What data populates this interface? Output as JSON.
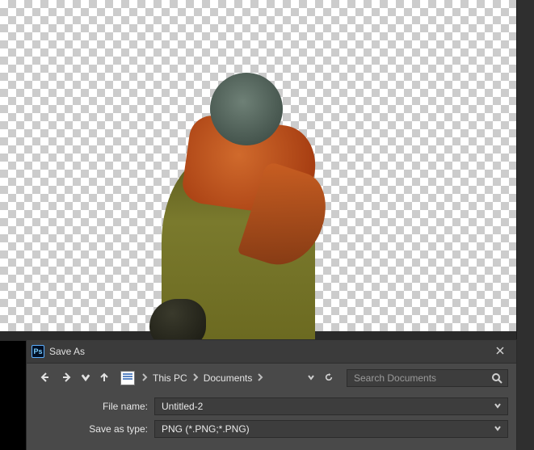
{
  "canvas": {
    "subject_icon": "person-back-cutout"
  },
  "dialog": {
    "ps_glyph": "Ps",
    "title": "Save As",
    "breadcrumbs": [
      "This PC",
      "Documents"
    ],
    "search_placeholder": "Search Documents",
    "filename_label": "File name:",
    "filename_value": "Untitled-2",
    "savetype_label": "Save as type:",
    "savetype_value": "PNG (*.PNG;*.PNG)"
  }
}
